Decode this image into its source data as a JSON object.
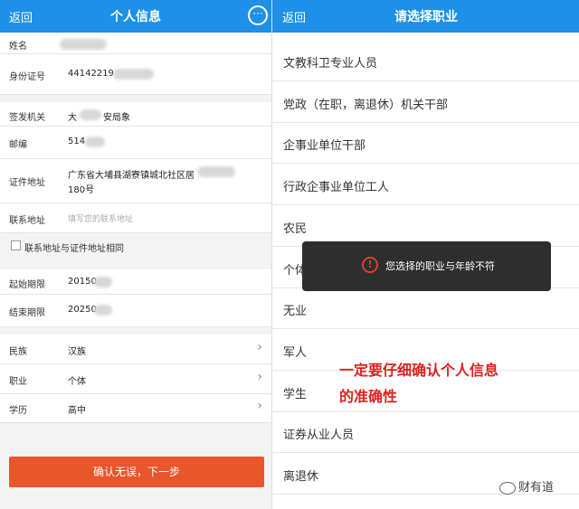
{
  "left": {
    "header": {
      "back": "返回",
      "title": "个人信息",
      "more_icon": "chat-more-icon"
    },
    "rows": {
      "name": {
        "label": "姓名"
      },
      "idno": {
        "label": "身份证号",
        "value": "44142219"
      },
      "issuer": {
        "label": "签发机关",
        "value_a": "大",
        "value_b": "安局象"
      },
      "postcode": {
        "label": "邮编",
        "value": "514"
      },
      "cert_addr": {
        "label": "证件地址",
        "line1": "广东省大埔县湖寮镇城北社区居",
        "line2": "180号"
      },
      "contact_addr": {
        "label": "联系地址",
        "placeholder": "填写您的联系地址"
      },
      "same_addr": {
        "label": "联系地址与证件地址相同"
      },
      "start": {
        "label": "起始期限",
        "value": "20150"
      },
      "end": {
        "label": "结束期限",
        "value": "20250"
      },
      "ethnic": {
        "label": "民族",
        "value": "汉族"
      },
      "job": {
        "label": "职业",
        "value": "个体"
      },
      "edu": {
        "label": "学历",
        "value": "高中"
      }
    },
    "confirm_button": "确认无误，下一步"
  },
  "right": {
    "header": {
      "back": "返回",
      "title": "请选择职业"
    },
    "occupations": [
      "文教科卫专业人员",
      "党政（在职，离退休）机关干部",
      "企事业单位干部",
      "行政企事业单位工人",
      "农民",
      "个体",
      "无业",
      "军人",
      "学生",
      "证券从业人员",
      "离退休"
    ],
    "toast": {
      "message": "您选择的职业与年龄不符",
      "icon": "warning-icon"
    }
  },
  "annotation": {
    "line1": "一定要仔细确认个人信息",
    "line2": "的准确性"
  },
  "watermark": "财有道",
  "colors": {
    "header_blue": "#1e90e8",
    "confirm_orange": "#e8562b",
    "annotation_red": "#e0201f"
  }
}
